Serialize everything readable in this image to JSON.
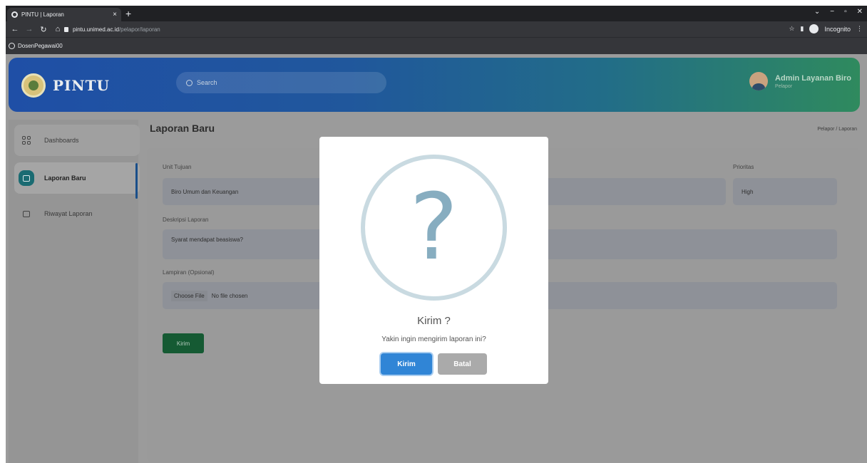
{
  "browser": {
    "tab_title": "PINTU | Laporan",
    "tab_close": "×",
    "new_tab": "+",
    "window_controls": [
      "⌄",
      "−",
      "▫",
      "✕"
    ],
    "url_host": "pintu.unimed.ac.id",
    "url_path": "/pelapor/laporan",
    "incognito_label": "Incognito",
    "bookmark_label": "DosenPegawai00"
  },
  "header": {
    "brand": "PINTU",
    "search_placeholder": "Search",
    "user_name": "Admin Layanan Biro",
    "user_role": "Pelapor"
  },
  "sidebar": {
    "items": [
      {
        "label": "Dashboards"
      },
      {
        "label": "Laporan Baru"
      },
      {
        "label": "Riwayat Laporan"
      }
    ]
  },
  "main": {
    "title": "Laporan Baru",
    "breadcrumb": "Pelapor  /  Laporan",
    "form": {
      "unit_label": "Unit Tujuan",
      "unit_value": "Biro Umum dan Keuangan",
      "priority_label": "Prioritas",
      "priority_value": "High",
      "desc_label": "Deskripsi Laporan",
      "desc_value": "Syarat mendapat beasiswa?",
      "attachment_label": "Lampiran (Opsional)",
      "choose_file": "Choose File",
      "no_file": "No file chosen",
      "submit": "Kirim"
    }
  },
  "modal": {
    "icon": "?",
    "title": "Kirim ?",
    "text": "Yakin ingin mengirim laporan ini?",
    "confirm": "Kirim",
    "cancel": "Batal"
  },
  "colors": {
    "confirm": "#3085d6",
    "cancel": "#aaaaaa",
    "question": "#87adc0"
  }
}
